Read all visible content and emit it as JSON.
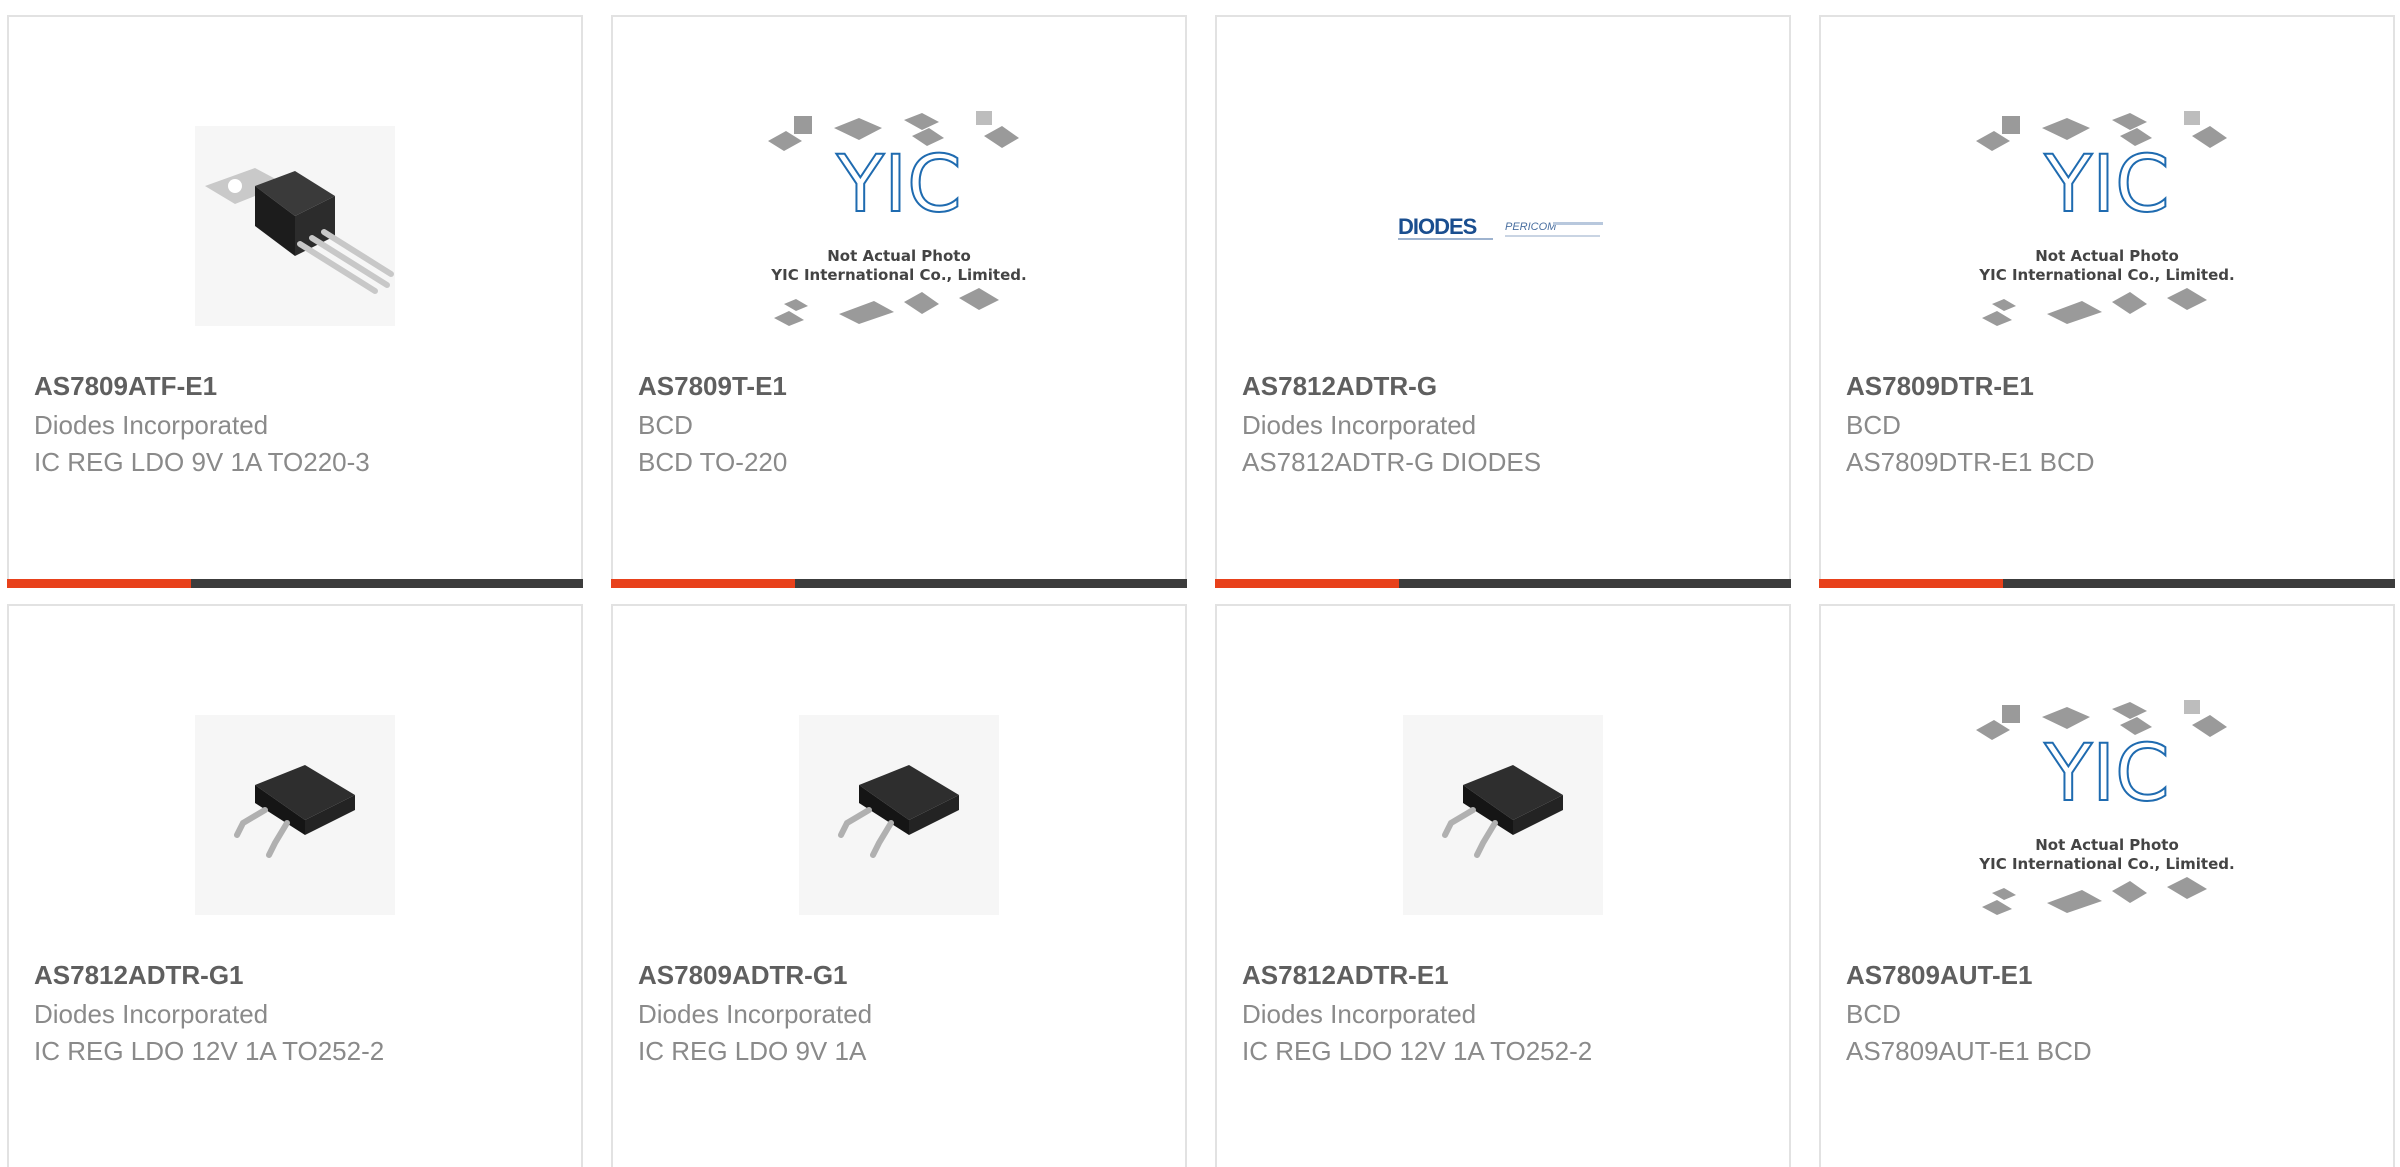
{
  "products": [
    {
      "part_number": "AS7809ATF-E1",
      "manufacturer": "Diodes Incorporated",
      "description": "IC REG LDO 9V 1A TO220-3",
      "image": "to220-package-photo"
    },
    {
      "part_number": "AS7809T-E1",
      "manufacturer": "BCD",
      "description": "BCD TO-220",
      "image": "yic-placeholder"
    },
    {
      "part_number": "AS7812ADTR-G",
      "manufacturer": "Diodes Incorporated",
      "description": "AS7812ADTR-G DIODES",
      "image": "diodes-pericom-logo"
    },
    {
      "part_number": "AS7809DTR-E1",
      "manufacturer": "BCD",
      "description": "AS7809DTR-E1 BCD",
      "image": "yic-placeholder"
    },
    {
      "part_number": "AS7812ADTR-G1",
      "manufacturer": "Diodes Incorporated",
      "description": "IC REG LDO 12V 1A TO252-2",
      "image": "to252-package-photo"
    },
    {
      "part_number": "AS7809ADTR-G1",
      "manufacturer": "Diodes Incorporated",
      "description": "IC REG LDO 9V 1A",
      "image": "to252-package-photo"
    },
    {
      "part_number": "AS7812ADTR-E1",
      "manufacturer": "Diodes Incorporated",
      "description": "IC REG LDO 12V 1A TO252-2",
      "image": "to252-package-photo"
    },
    {
      "part_number": "AS7809AUT-E1",
      "manufacturer": "BCD",
      "description": "AS7809AUT-E1 BCD",
      "image": "yic-placeholder"
    }
  ],
  "placeholder": {
    "brand": "YIC",
    "line1": "Not Actual Photo",
    "line2": "YIC International Co., Limited."
  },
  "diodes_logo": {
    "brand": "DIODES",
    "sub": "PERICOM"
  },
  "colors": {
    "accent_bar": "#e8411b",
    "bar_rest": "#3c3c3c",
    "part_number_text": "#5f5f5f",
    "secondary_text": "#8a8a8a",
    "card_border": "#e2e2e2"
  }
}
